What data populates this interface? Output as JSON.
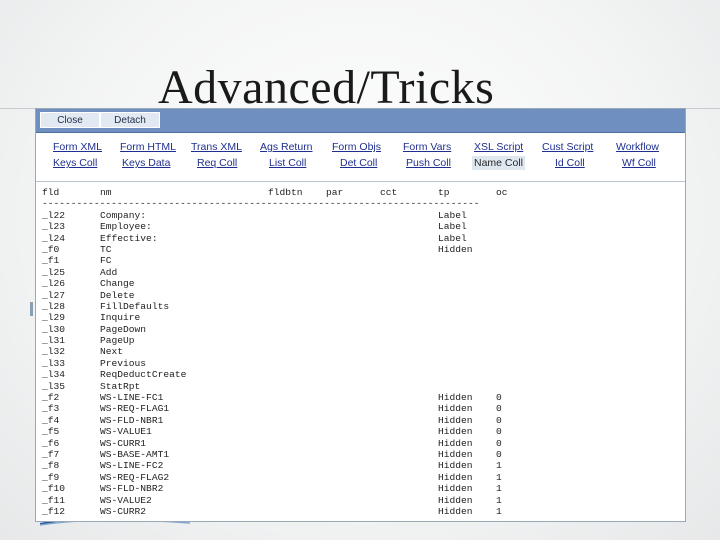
{
  "slide": {
    "title": "Advanced/Tricks"
  },
  "toolbar": {
    "close_label": "Close",
    "detach_label": "Detach"
  },
  "tabs": {
    "row1": [
      "Form XML",
      "Form HTML",
      "Trans XML",
      "Ags Return",
      "Form Objs",
      "Form Vars",
      "XSL Script",
      "Cust Script",
      "Workflow"
    ],
    "row2": [
      "Keys Coll",
      "Keys Data",
      "Req Coll",
      "List Coll",
      "Det Coll",
      "Push Coll",
      "Name Coll",
      "Id Coll",
      "Wf Coll"
    ],
    "active": "Name Coll"
  },
  "listing": {
    "headers": {
      "fld": "fld",
      "nm": "nm",
      "fldbtn": "fldbtn",
      "par": "par",
      "cct": "cct",
      "tp": "tp",
      "oc": "oc"
    },
    "separator": "----------------------------------------------------------------------------",
    "rows": [
      {
        "fld": "_l22",
        "nm": "Company:",
        "tp": "Label",
        "oc": ""
      },
      {
        "fld": "_l23",
        "nm": "Employee:",
        "tp": "Label",
        "oc": ""
      },
      {
        "fld": "_l24",
        "nm": "Effective:",
        "tp": "Label",
        "oc": ""
      },
      {
        "fld": "_f0",
        "nm": "TC",
        "tp": "Hidden",
        "oc": ""
      },
      {
        "fld": "_f1",
        "nm": "FC",
        "tp": "",
        "oc": ""
      },
      {
        "fld": "_l25",
        "nm": "Add",
        "tp": "",
        "oc": ""
      },
      {
        "fld": "_l26",
        "nm": "Change",
        "tp": "",
        "oc": ""
      },
      {
        "fld": "_l27",
        "nm": "Delete",
        "tp": "",
        "oc": ""
      },
      {
        "fld": "_l28",
        "nm": "FillDefaults",
        "tp": "",
        "oc": ""
      },
      {
        "fld": "_l29",
        "nm": "Inquire",
        "tp": "",
        "oc": ""
      },
      {
        "fld": "_l30",
        "nm": "PageDown",
        "tp": "",
        "oc": ""
      },
      {
        "fld": "_l31",
        "nm": "PageUp",
        "tp": "",
        "oc": ""
      },
      {
        "fld": "_l32",
        "nm": "Next",
        "tp": "",
        "oc": ""
      },
      {
        "fld": "_l33",
        "nm": "Previous",
        "tp": "",
        "oc": ""
      },
      {
        "fld": "_l34",
        "nm": "ReqDeductCreate",
        "tp": "",
        "oc": ""
      },
      {
        "fld": "_l35",
        "nm": "StatRpt",
        "tp": "",
        "oc": ""
      },
      {
        "fld": "_f2",
        "nm": "WS-LINE-FC1",
        "tp": "Hidden",
        "oc": "0"
      },
      {
        "fld": "_f3",
        "nm": "WS-REQ-FLAG1",
        "tp": "Hidden",
        "oc": "0"
      },
      {
        "fld": "_f4",
        "nm": "WS-FLD-NBR1",
        "tp": "Hidden",
        "oc": "0"
      },
      {
        "fld": "_f5",
        "nm": "WS-VALUE1",
        "tp": "Hidden",
        "oc": "0"
      },
      {
        "fld": "_f6",
        "nm": "WS-CURR1",
        "tp": "Hidden",
        "oc": "0"
      },
      {
        "fld": "_f7",
        "nm": "WS-BASE-AMT1",
        "tp": "Hidden",
        "oc": "0"
      },
      {
        "fld": "_f8",
        "nm": "WS-LINE-FC2",
        "tp": "Hidden",
        "oc": "1"
      },
      {
        "fld": "_f9",
        "nm": "WS-REQ-FLAG2",
        "tp": "Hidden",
        "oc": "1"
      },
      {
        "fld": "_f10",
        "nm": "WS-FLD-NBR2",
        "tp": "Hidden",
        "oc": "1"
      },
      {
        "fld": "_f11",
        "nm": "WS-VALUE2",
        "tp": "Hidden",
        "oc": "1"
      },
      {
        "fld": "_f12",
        "nm": "WS-CURR2",
        "tp": "Hidden",
        "oc": "1"
      }
    ]
  },
  "colors": {
    "toolbar": "#6e8fbf",
    "tab_link": "#1f2f8f",
    "active_tab_bg": "#dfe7ef"
  }
}
